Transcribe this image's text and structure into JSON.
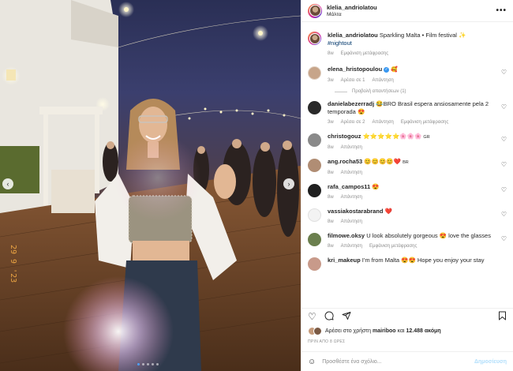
{
  "photo": {
    "nav_prev": "‹",
    "nav_next": "›",
    "date_stamp": "29 9 '23",
    "carousel": {
      "count": 5,
      "active": 1
    }
  },
  "header": {
    "username": "klelia_andriolatou",
    "location": "Μάλτα",
    "more": "•••"
  },
  "caption": {
    "username": "klelia_andriolatou",
    "text": "Sparkling Malta • Film festival ✨",
    "hashtag": "#nightout",
    "age": "8w",
    "translate": "Εμφάνιση μετάφρασης"
  },
  "comments": [
    {
      "username": "elena_hristopoulou",
      "text": "🥰",
      "age": "3w",
      "likes": "Αρέσει σε 1",
      "reply": "Απάντηση",
      "verified": "✓",
      "view_replies": "Προβολή απαντήσεων (1)"
    },
    {
      "username": "danielabezerradj",
      "text": "😂BRO Brasil espera ansiosamente pela 2 temporada 😍",
      "age": "3w",
      "likes": "Αρέσει σε 2",
      "reply": "Απάντηση",
      "translate": "Εμφάνιση μετάφρασης"
    },
    {
      "username": "christogouz",
      "text": "⭐⭐⭐⭐⭐🌸🌸🌸",
      "suffix": "GR",
      "age": "8w",
      "reply": "Απάντηση"
    },
    {
      "username": "ang.rocha53",
      "text": "😊😊😊😊❤️",
      "suffix": "BR",
      "age": "8w",
      "reply": "Απάντηση"
    },
    {
      "username": "rafa_campos11",
      "text": "😍",
      "age": "8w",
      "reply": "Απάντηση"
    },
    {
      "username": "vassiakostarabrand",
      "text": "❤️",
      "age": "8w",
      "reply": "Απάντηση"
    },
    {
      "username": "filmowe.oksy",
      "text": "U look absolutely gorgeous 😍 love the glasses",
      "age": "8w",
      "reply": "Απάντηση",
      "translate": "Εμφάνιση μετάφρασης"
    },
    {
      "username": "kri_makeup",
      "text": "I'm from Malta 😍😍 Hope you enjoy your stay"
    }
  ],
  "likes": {
    "prefix": "Αρέσει στο χρήστη ",
    "user": "mairiboo",
    "middle": " και ",
    "count": "12.488 ακόμη"
  },
  "posted": "ΠΡΙΝ ΑΠΟ 8 ΩΡΕΣ",
  "composer": {
    "placeholder": "Προσθέστε ένα σχόλιο...",
    "post": "Δημοσίευση"
  }
}
